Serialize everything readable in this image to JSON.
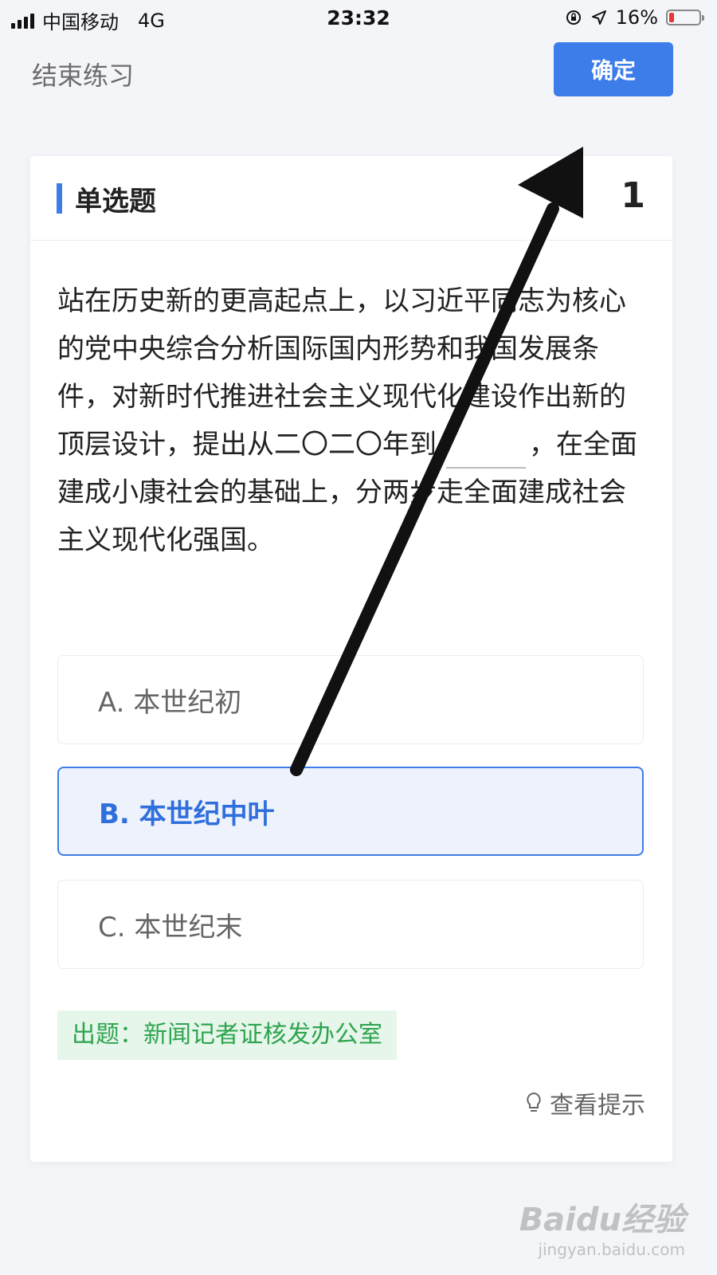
{
  "status_bar": {
    "carrier": "中国移动",
    "network": "4G",
    "time": "23:32",
    "battery": "16%",
    "battery_level": 0.16
  },
  "header": {
    "exit_label": "结束练习",
    "confirm_label": "确定",
    "accent_color": "#3d7de9"
  },
  "question": {
    "type_label": "单选题",
    "number": "1",
    "text_before_blank": "站在历史新的更高起点上，以习近平同志为核心的党中央综合分析国际国内形势和我国发展条件，对新时代推进社会主义现代化建设作出新的顶层设计，提出从二〇二〇年到",
    "text_after_blank": "，在全面建成小康社会的基础上，分两步走全面建成社会主义现代化强国。",
    "options": [
      {
        "label": "A. 本世纪初",
        "selected": false
      },
      {
        "label": "B. 本世纪中叶",
        "selected": true
      },
      {
        "label": "C. 本世纪末",
        "selected": false
      }
    ],
    "source": "出题：新闻记者证核发办公室",
    "hint_label": "查看提示"
  },
  "watermark": {
    "logo": "Baidu经验",
    "url": "jingyan.baidu.com"
  }
}
